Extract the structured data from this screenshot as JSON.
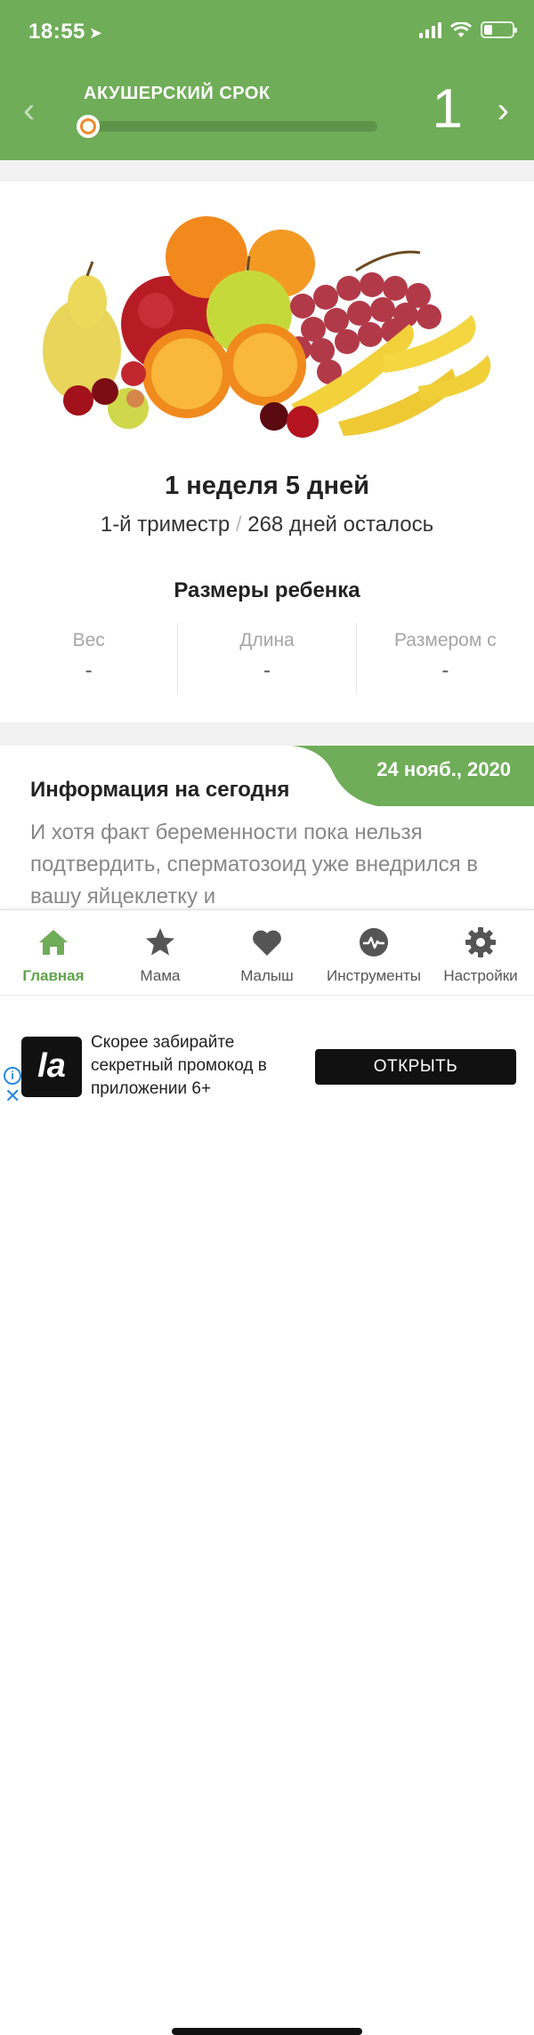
{
  "status": {
    "time": "18:55"
  },
  "header": {
    "term_label": "АКУШЕРСКИЙ СРОК",
    "week_number": "1",
    "progress_fraction": 0.02
  },
  "week": {
    "title": "1 неделя 5 дней",
    "trimester": "1-й триместр",
    "separator": "/",
    "remaining": "268 дней осталось"
  },
  "sizes": {
    "title": "Размеры ребенка",
    "items": [
      {
        "label": "Вес",
        "value": "-"
      },
      {
        "label": "Длина",
        "value": "-"
      },
      {
        "label": "Размером с",
        "value": "-"
      }
    ]
  },
  "info": {
    "date": "24 нояб., 2020",
    "title": "Информация на сегодня",
    "body": "И хотя факт беременности пока нельзя подтвердить, сперматозоид уже внедрился в вашу яйцеклетку и"
  },
  "tabs": [
    {
      "label": "Главная",
      "icon": "home-icon",
      "active": true
    },
    {
      "label": "Мама",
      "icon": "star-icon",
      "active": false
    },
    {
      "label": "Малыш",
      "icon": "heart-icon",
      "active": false
    },
    {
      "label": "Инструменты",
      "icon": "pulse-icon",
      "active": false
    },
    {
      "label": "Настройки",
      "icon": "gear-icon",
      "active": false
    }
  ],
  "ad": {
    "logo_text": "la",
    "text": "Скорее забирайте секретный промокод в приложении 6+",
    "button": "ОТКРЫТЬ"
  },
  "colors": {
    "brand_green": "#6fad58",
    "active_tab": "#5fa54a",
    "progress_knob": "#f08a2b"
  }
}
